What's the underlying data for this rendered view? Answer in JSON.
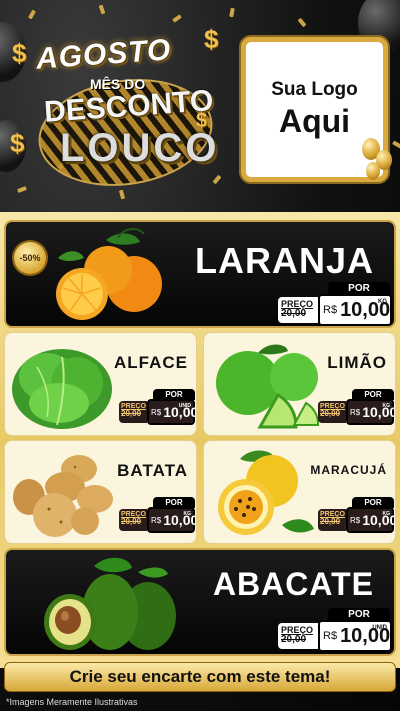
{
  "header": {
    "title_line1": "AGOSTO",
    "title_line2": "MÊS DO",
    "title_line3": "DESCONTO",
    "title_line4": "LOUCO",
    "currency_symbol": "$",
    "logo_line1": "Sua Logo",
    "logo_line2": "Aqui"
  },
  "products": [
    {
      "name": "LARANJA",
      "badge": "-50%",
      "price_tag": "POR",
      "old_label": "PREÇO",
      "old_price": "20,00",
      "currency": "R$",
      "new_price": "10,00",
      "unit": "KG"
    },
    {
      "name": "ALFACE",
      "price_tag": "POR",
      "old_label": "PREÇO",
      "old_price": "20,00",
      "currency": "R$",
      "new_price": "10,00",
      "unit": "UNID"
    },
    {
      "name": "LIMÃO",
      "price_tag": "POR",
      "old_label": "PREÇO",
      "old_price": "20,00",
      "currency": "R$",
      "new_price": "10,00",
      "unit": "KG"
    },
    {
      "name": "BATATA",
      "price_tag": "POR",
      "old_label": "PREÇO",
      "old_price": "20,00",
      "currency": "R$",
      "new_price": "10,00",
      "unit": "KG"
    },
    {
      "name": "MARACUJÁ",
      "price_tag": "POR",
      "old_label": "PREÇO",
      "old_price": "20,00",
      "currency": "R$",
      "new_price": "10,00",
      "unit": "KG"
    },
    {
      "name": "ABACATE",
      "price_tag": "POR",
      "old_label": "PREÇO",
      "old_price": "20,00",
      "currency": "R$",
      "new_price": "10,00",
      "unit": "UNID"
    }
  ],
  "footer": {
    "banner": "Crie seu encarte com este tema!",
    "disclaimer": "*Imagens Meramente Ilustrativas"
  },
  "colors": {
    "gold": "#d9aa3f",
    "dark_card": "#0a0a0a",
    "light_card": "#fbf5de",
    "banner": "#f0c654"
  },
  "icons": [
    "orange-icon",
    "lettuce-icon",
    "lime-icon",
    "potato-icon",
    "passion-fruit-icon",
    "avocado-icon",
    "dollar-sign-icon",
    "balloon-icon"
  ]
}
